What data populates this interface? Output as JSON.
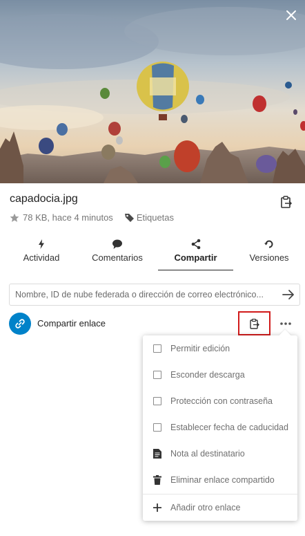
{
  "file": {
    "name": "capadocia.jpg",
    "size_time": "78 KB, hace 4 minutos",
    "tags_label": "Etiquetas"
  },
  "tabs": [
    {
      "label": "Actividad",
      "icon": "bolt-icon"
    },
    {
      "label": "Comentarios",
      "icon": "comment-icon"
    },
    {
      "label": "Compartir",
      "icon": "share-icon",
      "active": true
    },
    {
      "label": "Versiones",
      "icon": "history-icon"
    }
  ],
  "share": {
    "placeholder": "Nombre, ID de nube federada o dirección de correo electrónico...",
    "link_label": "Compartir enlace"
  },
  "menu": {
    "items": [
      {
        "label": "Permitir edición",
        "type": "checkbox",
        "checked": false
      },
      {
        "label": "Esconder descarga",
        "type": "checkbox",
        "checked": false
      },
      {
        "label": "Protección con contraseña",
        "type": "checkbox",
        "checked": false
      },
      {
        "label": "Establecer fecha de caducidad",
        "type": "checkbox",
        "checked": false
      },
      {
        "label": "Nota al destinatario",
        "type": "action",
        "icon": "note-icon"
      },
      {
        "label": "Eliminar enlace compartido",
        "type": "action",
        "icon": "trash-icon"
      },
      {
        "label": "Añadir otro enlace",
        "type": "action",
        "icon": "plus-icon"
      }
    ]
  },
  "colors": {
    "accent": "#0082c9",
    "highlight_border": "#d11a1a"
  }
}
